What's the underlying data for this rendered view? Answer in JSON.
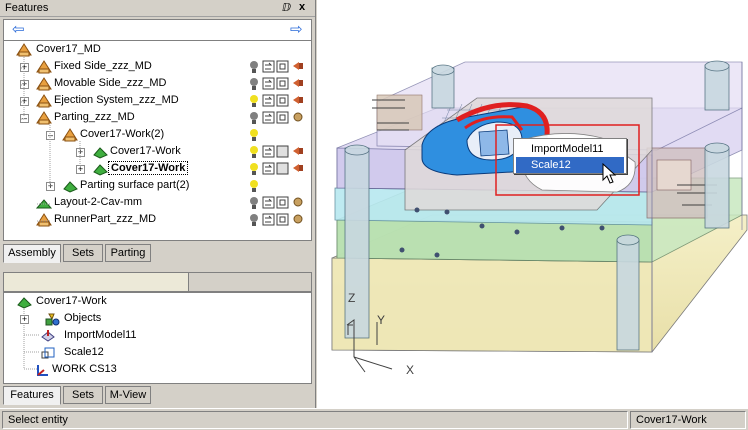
{
  "panel": {
    "title": "Features",
    "pin_glyph": "ⅅ",
    "close_glyph": "x"
  },
  "tree": {
    "root": "Cover17_MD",
    "items": [
      {
        "label": "Fixed Side_zzz_MD"
      },
      {
        "label": "Movable Side_zzz_MD"
      },
      {
        "label": "Ejection System_zzz_MD"
      },
      {
        "label": "Parting_zzz_MD"
      },
      {
        "label": "Cover17-Work(2)"
      },
      {
        "label": "Cover17-Work"
      },
      {
        "label": "Cover17-Work"
      },
      {
        "label": "Parting surface part(2)"
      },
      {
        "label": "Layout-2-Cav-mm"
      },
      {
        "label": "RunnerPart_zzz_MD"
      }
    ]
  },
  "tabs_top": [
    "Assembly",
    "Sets",
    "Parting"
  ],
  "feature_tree": {
    "root": "Cover17-Work",
    "items": [
      "Objects",
      "ImportModel11",
      "Scale12",
      "WORK CS13"
    ]
  },
  "tabs_bottom": [
    "Features",
    "Sets",
    "M-View"
  ],
  "context_menu": {
    "items": [
      "ImportModel11",
      "Scale12"
    ],
    "highlighted": 1
  },
  "axes": {
    "x": "X",
    "y": "Y",
    "z": "Z"
  },
  "status": {
    "left": "Select entity",
    "right": "Cover17-Work"
  },
  "colors": {
    "selection": "#316ac5",
    "highlight_box": "#e02020",
    "part_blue": "#2f8fe0"
  }
}
